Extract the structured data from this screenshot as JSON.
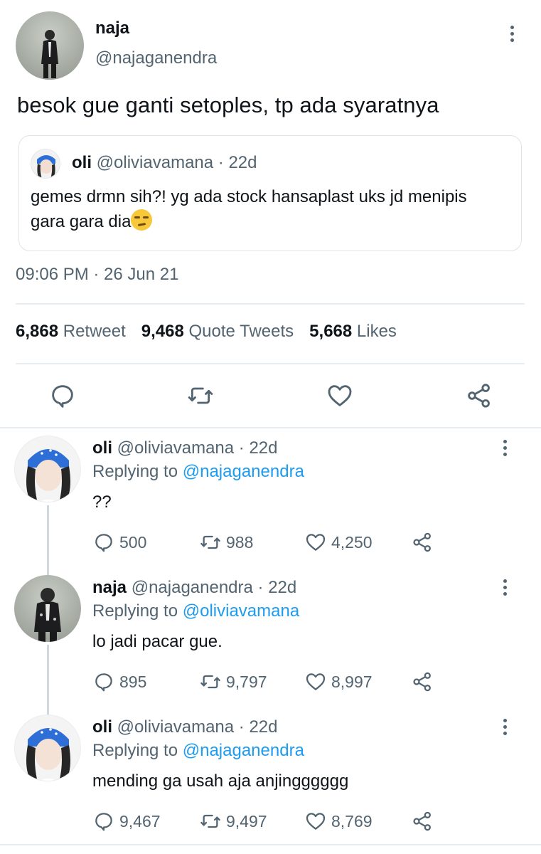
{
  "main_tweet": {
    "author_name": "naja",
    "author_handle": "@najaganendra",
    "text": "besok gue ganti setoples, tp ada syaratnya",
    "quote": {
      "author_name": "oli",
      "author_handle": "@oliviavamana",
      "age": "22d",
      "text": "gemes drmn sih?! yg ada stock hansaplast uks jd menipis gara gara dia"
    },
    "timestamp": "09:06 PM · 26 Jun 21",
    "stats": {
      "retweets_count": "6,868",
      "retweets_label": "Retweet",
      "quotes_count": "9,468",
      "quotes_label": "Quote Tweets",
      "likes_count": "5,668",
      "likes_label": "Likes"
    },
    "icons": [
      "reply-icon",
      "retweet-icon",
      "like-icon",
      "share-icon"
    ]
  },
  "replies": [
    {
      "author_name": "oli",
      "author_handle": "@oliviavamana",
      "age": "· 22d",
      "replying_prefix": "Replying to",
      "replying_to": "@najaganendra",
      "text": "??",
      "reply_count": "500",
      "retweet_count": "988",
      "like_count": "4,250"
    },
    {
      "author_name": "naja",
      "author_handle": "@najaganendra",
      "age": "· 22d",
      "replying_prefix": "Replying to",
      "replying_to": "@oliviavamana",
      "text": "lo jadi pacar gue.",
      "reply_count": "895",
      "retweet_count": "9,797",
      "like_count": "8,997"
    },
    {
      "author_name": "oli",
      "author_handle": "@oliviavamana",
      "age": "· 22d",
      "replying_prefix": "Replying to",
      "replying_to": "@najaganendra",
      "text": "mending ga usah aja anjingggggg",
      "reply_count": "9,467",
      "retweet_count": "9,497",
      "like_count": "8,769"
    }
  ],
  "colors": {
    "text_primary": "#0f1419",
    "text_secondary": "#536471",
    "link_blue": "#1d9bf0",
    "divider": "#e6ecf0"
  }
}
